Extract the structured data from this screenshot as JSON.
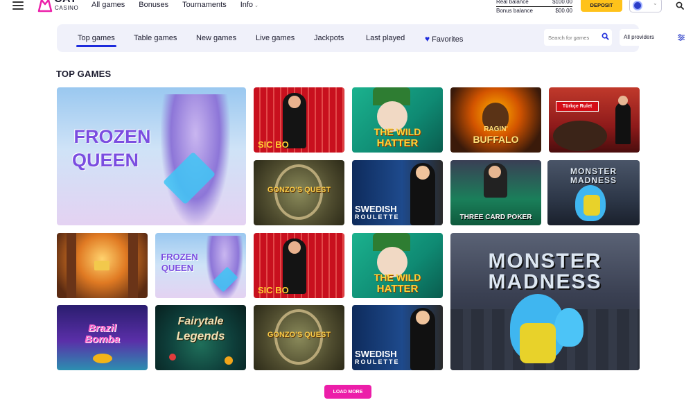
{
  "header": {
    "logo": {
      "main": "CAT",
      "sub": "CASINO"
    },
    "nav": [
      {
        "label": "All games"
      },
      {
        "label": "Bonuses"
      },
      {
        "label": "Tournaments"
      },
      {
        "label": "Info"
      }
    ],
    "balance": {
      "real_label": "Real balance",
      "real_value": "$100.00",
      "bonus_label": "Bonus balance",
      "bonus_value": "$00.00"
    },
    "deposit_label": "DEPOSIT"
  },
  "filters": {
    "tabs": [
      {
        "label": "Top games",
        "active": true
      },
      {
        "label": "Table games"
      },
      {
        "label": "New games"
      },
      {
        "label": "Live games"
      },
      {
        "label": "Jackpots"
      },
      {
        "label": "Last played"
      },
      {
        "label": "Favorites",
        "icon": "heart-icon"
      }
    ],
    "search_placeholder": "Search for games",
    "providers_label": "All providers"
  },
  "section": {
    "title": "TOP GAMES"
  },
  "games": [
    {
      "title_line1": "FROZEN",
      "title_line2": "QUEEN"
    },
    {
      "title_line1": "SIC BO",
      "title_line2": ""
    },
    {
      "title_line1": "THE WILD",
      "title_line2": "HATTER"
    },
    {
      "title_line1": "RAGIN'",
      "title_line2": "BUFFALO"
    },
    {
      "title_line1": "Türkçe Rulet",
      "title_line2": ""
    },
    {
      "title_line1": "GONZO'S QUEST",
      "title_line2": ""
    },
    {
      "title_line1": "SWEDISH",
      "title_line2": "ROULETTE"
    },
    {
      "title_line1": "THREE CARD POKER",
      "title_line2": ""
    },
    {
      "title_line1": "MONSTER",
      "title_line2": "MADNESS"
    },
    {
      "title_line1": "",
      "title_line2": ""
    },
    {
      "title_line1": "FROZEN",
      "title_line2": "QUEEN"
    },
    {
      "title_line1": "SIC BO",
      "title_line2": ""
    },
    {
      "title_line1": "THE WILD",
      "title_line2": "HATTER"
    },
    {
      "title_line1": "MONSTER",
      "title_line2": "MADNESS"
    },
    {
      "title_line1": "Brazil",
      "title_line2": "Bomba"
    },
    {
      "title_line1": "Fairytale",
      "title_line2": "Legends"
    },
    {
      "title_line1": "GONZO'S QUEST",
      "title_line2": ""
    },
    {
      "title_line1": "SWEDISH",
      "title_line2": "ROULETTE"
    }
  ],
  "load_more_label": "LOAD MORE",
  "colors": {
    "accent": "#1d2bdc",
    "deposit": "#ffc21a",
    "load_more": "#ec1ea9",
    "filterbar_bg": "#f0f1fa"
  }
}
